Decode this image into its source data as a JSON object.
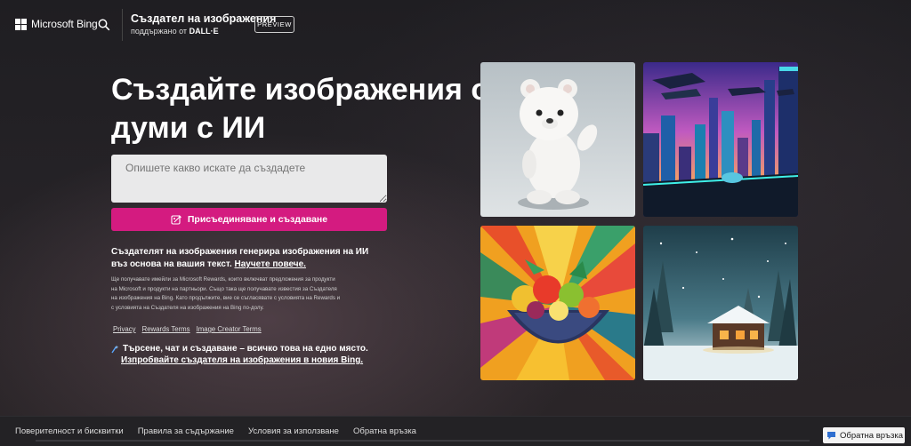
{
  "header": {
    "logo_text": "Microsoft Bing",
    "app_title": "Създател на изображения",
    "app_subtitle_prefix": "поддържано от",
    "app_subtitle_brand": "DALL·E",
    "preview_badge": "PREVIEW",
    "icons": [
      "microsoft-logo-icon",
      "search-icon"
    ]
  },
  "hero": {
    "title_line1": "Създайте изображения от",
    "title_line2": "думи с ИИ",
    "prompt_placeholder": "Опишете какво искате да създадете",
    "join_button": "Присъединяване и създаване",
    "info_text": "Създателят на изображения генерира изображения на ИИ въз основа на вашия текст.",
    "info_link": "Научете повече.",
    "fine_print": "Ще получавате имейли за Microsoft Rewards, които включват предложения за продукти на Microsoft и продукти на партньори. Също така ще получавате известия за Създателя на изображения на Bing. Като продължите, вие се съгласявате с условията на Rewards и с условията на Създателя на изображения на Bing по-долу.",
    "links": [
      "Privacy",
      "Rewards Terms",
      "Image Creator Terms"
    ],
    "promo_line1": "Търсене, чат и създаване – всичко това на едно място.",
    "promo_line2": "Изпробвайте създателя на изображения в новия Bing."
  },
  "gallery": {
    "images": [
      "polar-bear-toy",
      "futuristic-city",
      "fruit-bowl-art",
      "snowy-cabin"
    ]
  },
  "footer": {
    "links": [
      "Поверителност и бисквитки",
      "Правила за съдържание",
      "Условия за използване",
      "Обратна връзка"
    ],
    "feedback_button": "Обратна връзка"
  },
  "colors": {
    "accent": "#d41b80",
    "background": "#1f1e22",
    "input_bg": "#e9e9ea"
  }
}
